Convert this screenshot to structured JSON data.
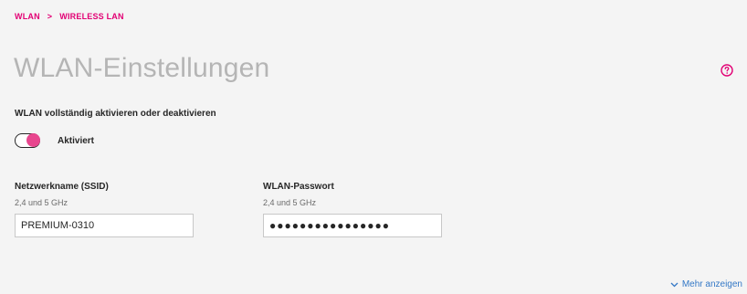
{
  "breadcrumb": {
    "items": [
      "WLAN",
      "WIRELESS LAN"
    ],
    "separator": ">"
  },
  "page": {
    "title": "WLAN-Einstellungen",
    "help_icon": "help-icon"
  },
  "wlan_toggle": {
    "section_label": "WLAN vollständig aktivieren oder deaktivieren",
    "state_label": "Aktiviert",
    "enabled": true
  },
  "ssid": {
    "label": "Netzwerkname (SSID)",
    "band": "2,4 und 5 GHz",
    "value": "PREMIUM-0310"
  },
  "password": {
    "label": "WLAN-Passwort",
    "band": "2,4 und 5 GHz",
    "masked_value": "●●●●●●●●●●●●●●●●"
  },
  "more": {
    "label": "Mehr anzeigen",
    "icon": "chevron-down-icon"
  },
  "colors": {
    "brand_magenta": "#e20074",
    "toggle_knob": "#e8468e",
    "link_blue": "#3478c6",
    "title_gray": "#b5b5b5",
    "background": "#f4f4f4"
  }
}
